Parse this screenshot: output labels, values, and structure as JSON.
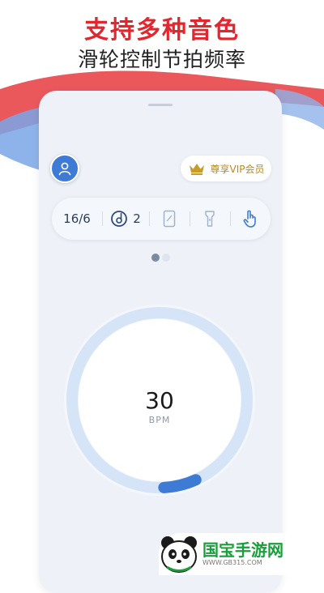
{
  "promo": {
    "title": "支持多种音色",
    "subtitle": "滑轮控制节拍频率"
  },
  "header": {
    "avatar_icon": "user-icon",
    "vip_label": "尊享VIP会员",
    "vip_icon": "crown-icon"
  },
  "toolbar": {
    "time_signature": "16/6",
    "beat_count": "2",
    "items": [
      "metronome-icon",
      "screen-icon",
      "flashlight-icon",
      "tap-icon"
    ]
  },
  "pager": {
    "pages": 2,
    "active": 1
  },
  "dial": {
    "bpm": "30",
    "unit": "BPM",
    "progress_fraction": 0.06
  },
  "watermark": {
    "name": "国宝手游网",
    "url": "WWW.GB315.COM"
  },
  "colors": {
    "accent": "#3e7bd5",
    "promo_red": "#e1262d",
    "vip_gold": "#c89b2a",
    "watermark_green": "#1a9e3b"
  }
}
